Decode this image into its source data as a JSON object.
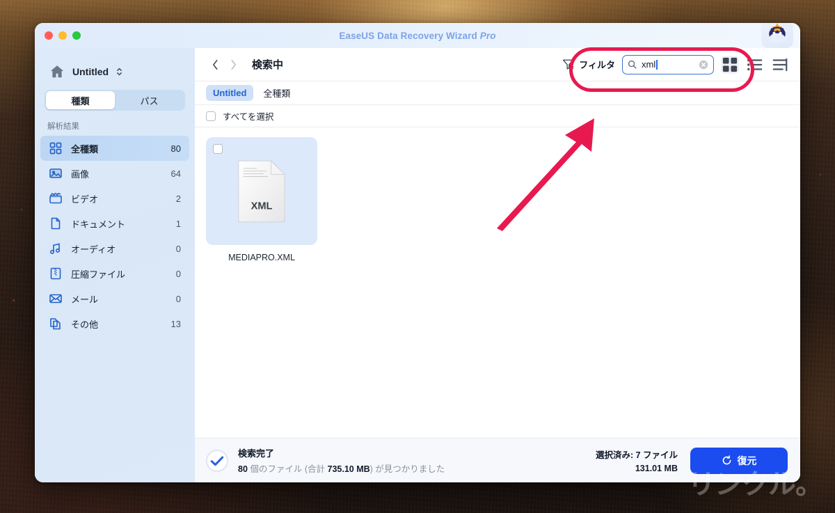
{
  "window": {
    "title": "EaseUS Data Recovery Wizard",
    "title_suffix": "Pro",
    "traffic_lights": [
      "close",
      "minimize",
      "zoom"
    ],
    "avatar_icon": "mascot-avatar"
  },
  "sidebar": {
    "home_icon": "home-icon",
    "project_name": "Untitled",
    "project_chevrons_icon": "chevron-up-down-icon",
    "segments": [
      {
        "label": "種類",
        "active": true
      },
      {
        "label": "パス",
        "active": false
      }
    ],
    "section_label": "解析結果",
    "items": [
      {
        "icon": "grid-icon",
        "label": "全種類",
        "count": "80",
        "active": true
      },
      {
        "icon": "image-icon",
        "label": "画像",
        "count": "64",
        "active": false
      },
      {
        "icon": "video-icon",
        "label": "ビデオ",
        "count": "2",
        "active": false
      },
      {
        "icon": "document-icon",
        "label": "ドキュメント",
        "count": "1",
        "active": false
      },
      {
        "icon": "audio-icon",
        "label": "オーディオ",
        "count": "0",
        "active": false
      },
      {
        "icon": "archive-icon",
        "label": "圧縮ファイル",
        "count": "0",
        "active": false
      },
      {
        "icon": "mail-icon",
        "label": "メール",
        "count": "0",
        "active": false
      },
      {
        "icon": "other-icon",
        "label": "その他",
        "count": "13",
        "active": false
      }
    ]
  },
  "toolbar": {
    "back_icon": "chevron-left-icon",
    "forward_icon": "chevron-right-icon",
    "breadcrumb": "検索中",
    "filter_icon": "filter-icon",
    "filter_label": "フィルタ",
    "search": {
      "icon": "search-icon",
      "value": "xml",
      "placeholder": "",
      "clear_icon": "clear-circle-icon"
    },
    "view_modes": [
      {
        "icon": "grid-view-icon",
        "active": true
      },
      {
        "icon": "list-view-icon",
        "active": false
      },
      {
        "icon": "detail-view-icon",
        "active": false
      }
    ]
  },
  "tabs": [
    {
      "label": "Untitled",
      "active": true
    },
    {
      "label": "全種類",
      "active": false
    }
  ],
  "select_all": {
    "checked": false,
    "label": "すべてを選択"
  },
  "files": [
    {
      "name": "MEDIAPRO.XML",
      "type_label": "XML",
      "checked": false,
      "icon": "xml-file-icon"
    }
  ],
  "status": {
    "check_icon": "check-circle-icon",
    "title": "検索完了",
    "detail_count": "80",
    "detail_mid": "個のファイル (合計",
    "detail_size": "735.10 MB",
    "detail_tail": ") が見つかりました",
    "selected_label": "選択済み: 7 ファイル",
    "selected_size": "131.01 MB",
    "restore_icon": "restore-rotate-icon",
    "restore_label": "復元"
  },
  "annotations": {
    "highlight_box": "search-area-highlight",
    "arrow": "pointer-arrow",
    "arrow_color": "#e8194f",
    "box_color": "#e8194f"
  },
  "watermark": {
    "text": "リンクル。"
  },
  "colors": {
    "accent_blue": "#1a4cf0",
    "title_blue": "#7ca2e8",
    "sidebar_bg": "#d9e7f7",
    "annotation_pink": "#e8194f",
    "selection_blue": "#cfe0f8"
  }
}
